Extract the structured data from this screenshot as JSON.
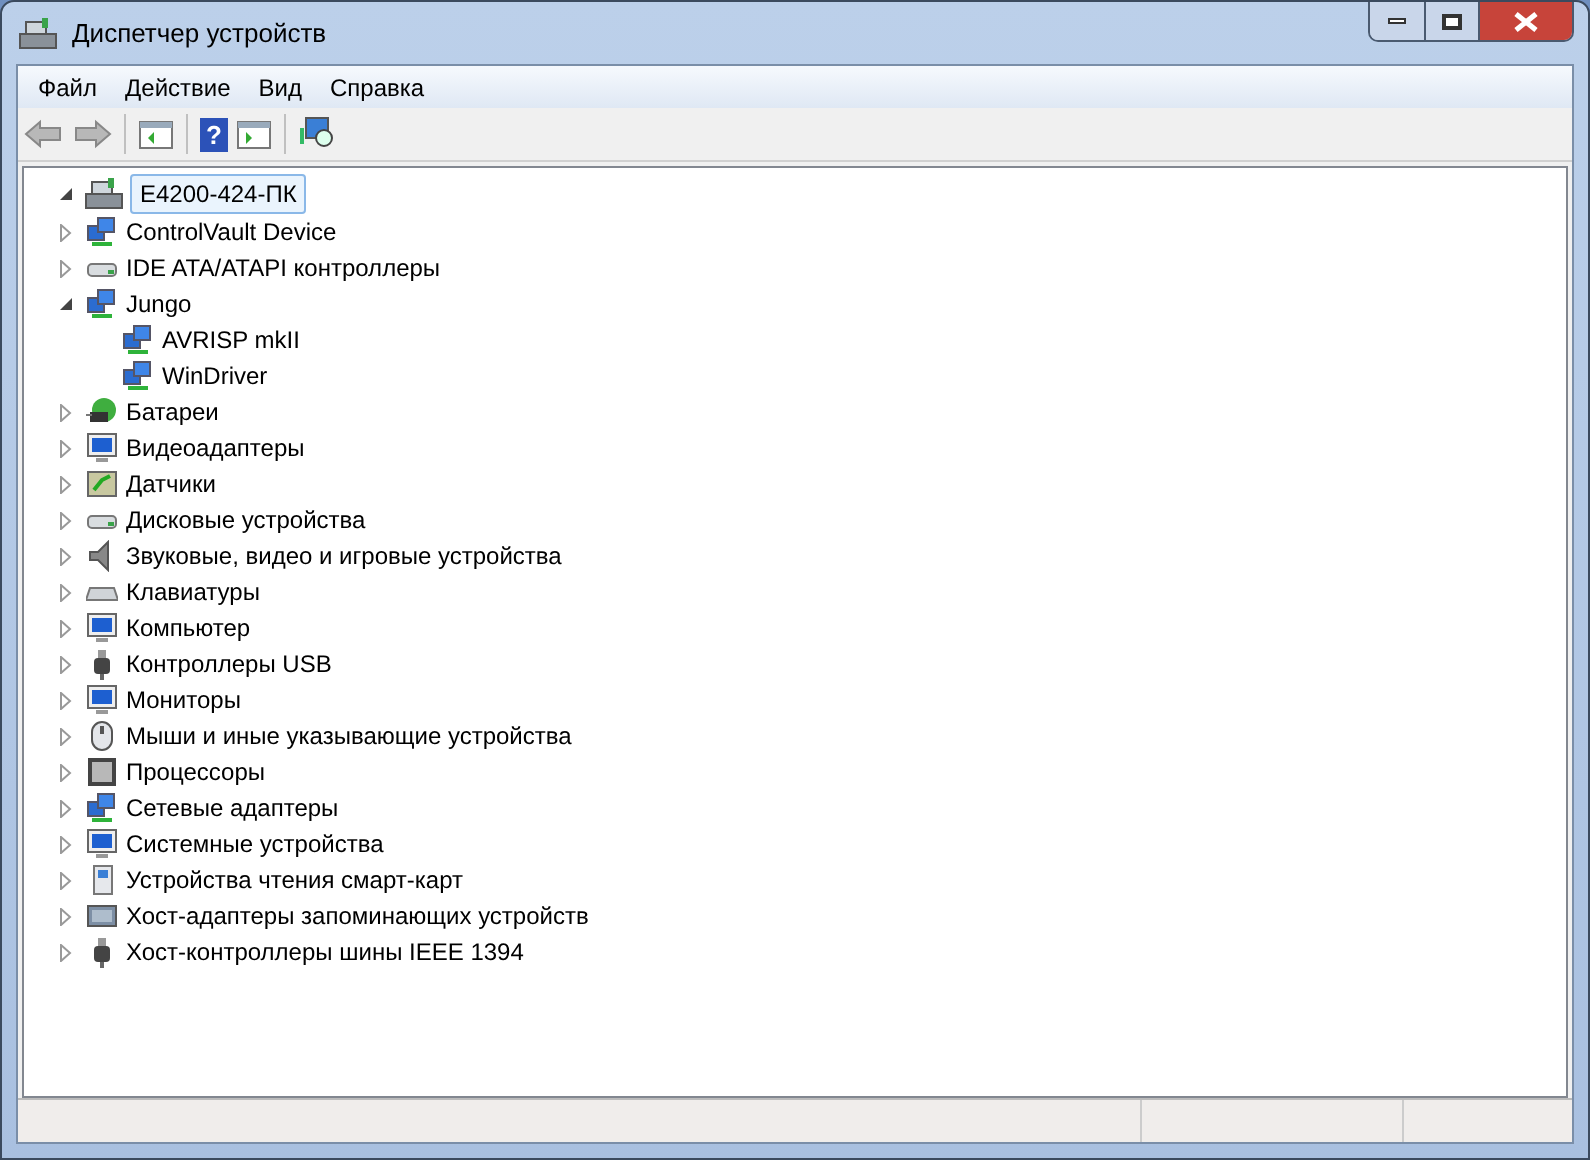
{
  "window": {
    "title": "Диспетчер устройств"
  },
  "menu": [
    "Файл",
    "Действие",
    "Вид",
    "Справка"
  ],
  "toolbar": [
    {
      "kind": "back",
      "disabled": true
    },
    {
      "kind": "forward",
      "disabled": true
    },
    {
      "kind": "sep"
    },
    {
      "kind": "tree-pane",
      "disabled": false
    },
    {
      "kind": "sep"
    },
    {
      "kind": "help",
      "glyph": "?",
      "disabled": false
    },
    {
      "kind": "action-pane",
      "disabled": false
    },
    {
      "kind": "sep"
    },
    {
      "kind": "scan",
      "disabled": false
    }
  ],
  "tree": {
    "label": "E4200-424-ПК",
    "kind": "computer-root",
    "expanded": true,
    "selected": true,
    "children": [
      {
        "label": "ControlVault Device",
        "kind": "network",
        "expanded": false
      },
      {
        "label": "IDE ATA/ATAPI контроллеры",
        "kind": "disk",
        "expanded": false
      },
      {
        "label": "Jungo",
        "kind": "network",
        "expanded": true,
        "children": [
          {
            "label": "AVRISP mkII",
            "kind": "network"
          },
          {
            "label": "WinDriver",
            "kind": "network"
          }
        ]
      },
      {
        "label": "Батареи",
        "kind": "battery",
        "expanded": false
      },
      {
        "label": "Видеоадаптеры",
        "kind": "monitor",
        "expanded": false
      },
      {
        "label": "Датчики",
        "kind": "sensor",
        "expanded": false
      },
      {
        "label": "Дисковые устройства",
        "kind": "disk",
        "expanded": false
      },
      {
        "label": "Звуковые, видео и игровые устройства",
        "kind": "speaker",
        "expanded": false
      },
      {
        "label": "Клавиатуры",
        "kind": "keyboard",
        "expanded": false
      },
      {
        "label": "Компьютер",
        "kind": "monitor",
        "expanded": false
      },
      {
        "label": "Контроллеры USB",
        "kind": "usb",
        "expanded": false
      },
      {
        "label": "Мониторы",
        "kind": "monitor",
        "expanded": false
      },
      {
        "label": "Мыши и иные указывающие устройства",
        "kind": "mouse",
        "expanded": false
      },
      {
        "label": "Процессоры",
        "kind": "chip",
        "expanded": false
      },
      {
        "label": "Сетевые адаптеры",
        "kind": "network",
        "expanded": false
      },
      {
        "label": "Системные устройства",
        "kind": "monitor",
        "expanded": false
      },
      {
        "label": "Устройства чтения смарт-карт",
        "kind": "smartcard",
        "expanded": false
      },
      {
        "label": "Хост-адаптеры запоминающих устройств",
        "kind": "storage",
        "expanded": false
      },
      {
        "label": "Хост-контроллеры шины IEEE 1394",
        "kind": "usb",
        "expanded": false
      }
    ]
  }
}
